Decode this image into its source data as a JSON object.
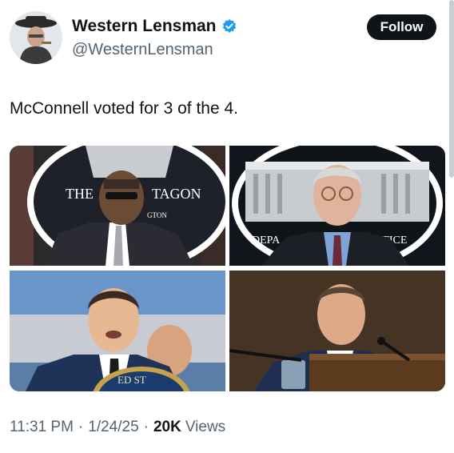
{
  "author": {
    "display_name": "Western Lensman",
    "handle": "@WesternLensman",
    "verified_icon": "verified-badge-icon",
    "verified_color": "#1d9bf0"
  },
  "follow_button": {
    "label": "Follow"
  },
  "tweet": {
    "text": "McConnell voted for 3 of the 4."
  },
  "media": {
    "photos": [
      {
        "name": "official-at-pentagon-podium",
        "seal_text_left": "THE",
        "seal_text_right": "TAGON",
        "seal_text_small": "GTON"
      },
      {
        "name": "official-at-justice-department-podium",
        "seal_text_left": "DEPA",
        "seal_text_right": "JUSTICE"
      },
      {
        "name": "official-speaking-at-podium-with-seal",
        "seal_text": "ED ST"
      },
      {
        "name": "official-at-hearing-microphone"
      }
    ]
  },
  "meta": {
    "time": "11:31 PM",
    "date": "1/24/25",
    "views_count": "20K",
    "views_label": "Views",
    "separator": "·"
  },
  "colors": {
    "text_primary": "#0f1419",
    "text_secondary": "#536471",
    "follow_bg": "#0f1419"
  }
}
